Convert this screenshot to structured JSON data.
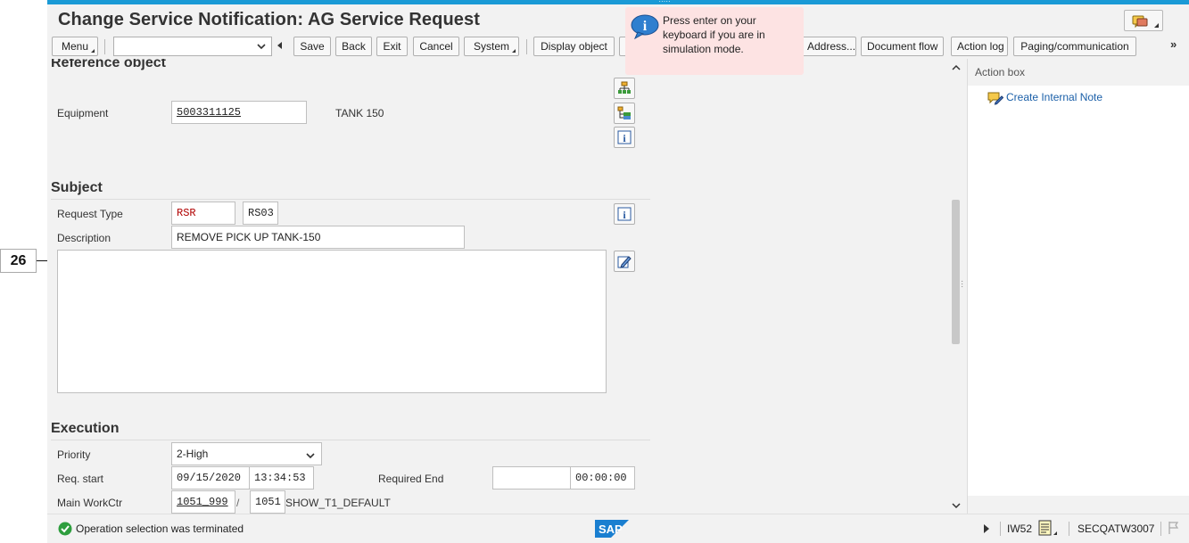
{
  "window": {
    "title": "Change Service Notification: AG Service Request"
  },
  "toolbar": {
    "menu": "Menu",
    "command_field_value": "",
    "save": "Save",
    "back": "Back",
    "exit": "Exit",
    "cancel": "Cancel",
    "system": "System",
    "display_object": "Display object",
    "address": "Address...",
    "document_flow": "Document flow",
    "action_log": "Action log",
    "paging": "Paging/communication",
    "more": "»"
  },
  "tooltip": {
    "text": "Press enter on your keyboard if you are in simulation mode."
  },
  "reference_object": {
    "heading": "Reference object",
    "equipment_label": "Equipment",
    "equipment_value": "5003311125",
    "equipment_desc": "TANK 150"
  },
  "subject": {
    "heading": "Subject",
    "request_type_label": "Request Type",
    "request_type_value": "RSR",
    "request_type_code": "RS03",
    "description_label": "Description",
    "description_value": "REMOVE PICK UP TANK-150",
    "long_text": ""
  },
  "execution": {
    "heading": "Execution",
    "priority_label": "Priority",
    "priority_value": "2-High",
    "req_start_label": "Req. start",
    "req_start_date": "09/15/2020",
    "req_start_time": "13:34:53",
    "required_end_label": "Required End",
    "required_end_date": "",
    "required_end_time": "00:00:00",
    "main_workctr_label": "Main WorkCtr",
    "main_workctr_value": "1051_999",
    "main_workctr_slash": "/",
    "main_workctr_plant": "1051",
    "main_workctr_desc": "SHOW_T1_DEFAULT"
  },
  "action_box": {
    "header": "Action box",
    "items": [
      {
        "label": "Create Internal Note"
      }
    ]
  },
  "status_bar": {
    "message": "Operation selection was terminated",
    "transaction": "IW52",
    "system": "SECQATW3007",
    "logo": "SAP"
  },
  "annotation": {
    "number": "26"
  },
  "colors": {
    "accent_blue": "#1a9ad6",
    "link_blue": "#1a5fa8",
    "required_red": "#b00000",
    "tooltip_bg": "#fde3e3",
    "success_green": "#2e9e3e"
  }
}
